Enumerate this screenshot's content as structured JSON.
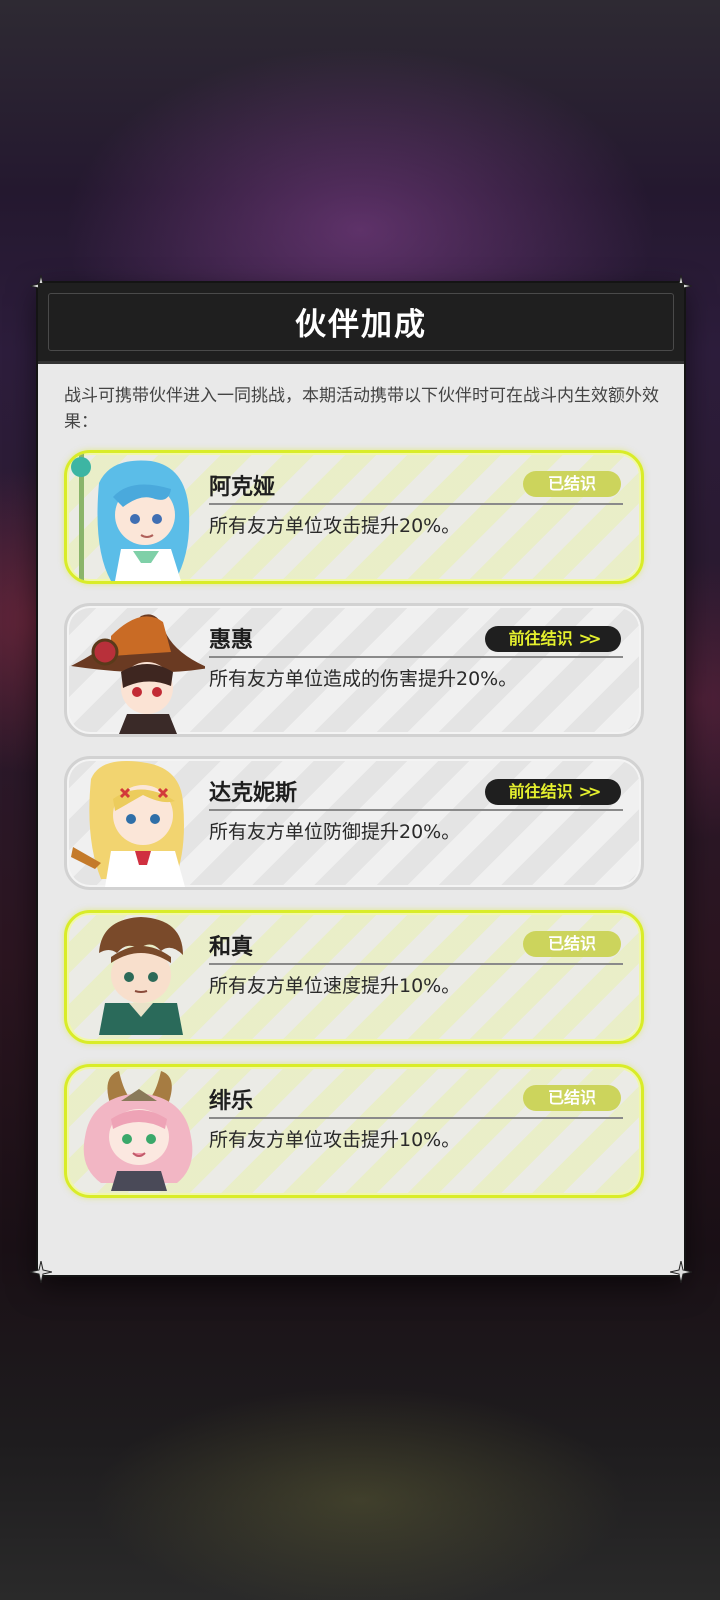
{
  "dialog": {
    "title": "伙伴加成",
    "description": "战斗可携带伙伴进入一同挑战，本期活动携带以下伙伴时可在战斗内生效额外效果："
  },
  "partners": [
    {
      "name": "阿克娅",
      "effect": "所有友方单位攻击提升20%。",
      "status": "已结识"
    },
    {
      "name": "惠惠",
      "effect": "所有友方单位造成的伤害提升20%。",
      "action": "前往结识"
    },
    {
      "name": "达克妮斯",
      "effect": "所有友方单位防御提升20%。",
      "action": "前往结识"
    },
    {
      "name": "和真",
      "effect": "所有友方单位速度提升10%。",
      "status": "已结识"
    },
    {
      "name": "绯乐",
      "effect": "所有友方单位攻击提升10%。",
      "status": "已结识"
    }
  ],
  "icons": {
    "corner": "corner-ornament-icon",
    "chevron": "double-chevron-right-icon"
  },
  "colors": {
    "met_border": "#d9ec28",
    "met_badge": "#ccd45c",
    "go_button_bg": "#1f1f1f",
    "go_button_text": "#e5f02e",
    "header_bg": "#1f1f1f"
  }
}
